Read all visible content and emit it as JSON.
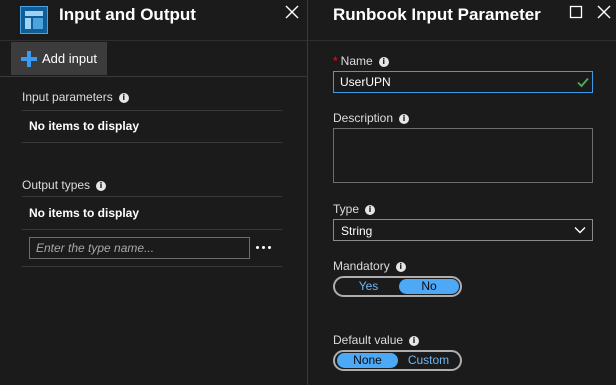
{
  "left_blade": {
    "title": "Input and Output",
    "icon": "runbook-blade-icon",
    "close_icon": "close-icon",
    "toolbar": {
      "add_input_label": "Add input",
      "add_icon": "plus-icon"
    },
    "input_parameters": {
      "label": "Input parameters",
      "empty_text": "No items to display"
    },
    "output_types": {
      "label": "Output types",
      "empty_text": "No items to display",
      "type_input_value": "",
      "type_input_placeholder": "Enter the type name...",
      "more_icon": "ellipsis-icon"
    },
    "info_icon": "info-icon"
  },
  "right_blade": {
    "title": "Runbook Input Parameter",
    "maximize_icon": "maximize-icon",
    "close_icon": "close-icon",
    "name": {
      "label": "Name",
      "required_marker": "*",
      "value": "UserUPN",
      "valid_icon": "checkmark-icon"
    },
    "description": {
      "label": "Description",
      "value": ""
    },
    "type": {
      "label": "Type",
      "selected": "String",
      "dropdown_icon": "chevron-down-icon"
    },
    "mandatory": {
      "label": "Mandatory",
      "options": [
        "Yes",
        "No"
      ],
      "selected": "No"
    },
    "default_value": {
      "label": "Default value",
      "options": [
        "None",
        "Custom"
      ],
      "selected": "None"
    }
  },
  "colors": {
    "background": "#1b1b1b",
    "accent": "#4da8f5",
    "focus_border": "#3b9be6",
    "required": "#e81123",
    "valid": "#4caf50",
    "button_bg": "#3c3c3c"
  }
}
